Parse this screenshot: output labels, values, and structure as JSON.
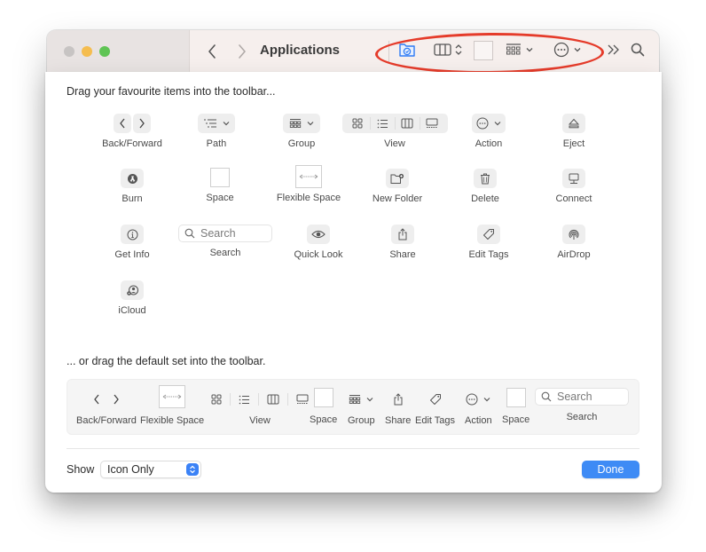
{
  "window": {
    "title": "Applications",
    "traffic_lights": [
      "close",
      "minimize",
      "zoom"
    ],
    "toolbar_items": [
      {
        "icon": "applications-folder-icon"
      },
      {
        "icon": "column-view-stepper-icon"
      },
      {
        "icon": "space-icon"
      },
      {
        "icon": "group-icon"
      },
      {
        "icon": "action-icon"
      },
      {
        "icon": "overflow-chevrons-icon"
      },
      {
        "icon": "search-icon"
      }
    ],
    "annotation_color": "#e53b2a"
  },
  "customize": {
    "heading": "Drag your favourite items into the toolbar...",
    "items": [
      {
        "label": "Back/Forward",
        "icon": "back-forward-icon"
      },
      {
        "label": "Path",
        "icon": "path-icon"
      },
      {
        "label": "Group",
        "icon": "group-icon"
      },
      {
        "label": "View",
        "icon": "view-icon"
      },
      {
        "label": "Action",
        "icon": "action-icon"
      },
      {
        "label": "Eject",
        "icon": "eject-icon"
      },
      {
        "label": "Burn",
        "icon": "burn-icon"
      },
      {
        "label": "Space",
        "icon": "space-icon"
      },
      {
        "label": "Flexible Space",
        "icon": "flexible-space-icon"
      },
      {
        "label": "New Folder",
        "icon": "new-folder-icon"
      },
      {
        "label": "Delete",
        "icon": "trash-icon"
      },
      {
        "label": "Connect",
        "icon": "connect-icon"
      },
      {
        "label": "Get Info",
        "icon": "info-icon"
      },
      {
        "label": "Search",
        "icon": "search-icon"
      },
      {
        "label": "Quick Look",
        "icon": "eye-icon"
      },
      {
        "label": "Share",
        "icon": "share-icon"
      },
      {
        "label": "Edit Tags",
        "icon": "tag-icon"
      },
      {
        "label": "AirDrop",
        "icon": "airdrop-icon"
      },
      {
        "label": "iCloud",
        "icon": "icloud-icon"
      }
    ],
    "search_placeholder": "Search",
    "default_heading": "... or drag the default set into the toolbar.",
    "default_set": [
      {
        "label": "Back/Forward"
      },
      {
        "label": "Flexible Space"
      },
      {
        "label": "View"
      },
      {
        "label": "Space"
      },
      {
        "label": "Group"
      },
      {
        "label": "Share"
      },
      {
        "label": "Edit Tags"
      },
      {
        "label": "Action"
      },
      {
        "label": "Space"
      },
      {
        "label": "Search"
      }
    ],
    "default_search_placeholder": "Search",
    "show_label": "Show",
    "show_value": "Icon Only",
    "done_label": "Done",
    "accent_color": "#3e8bf5"
  }
}
